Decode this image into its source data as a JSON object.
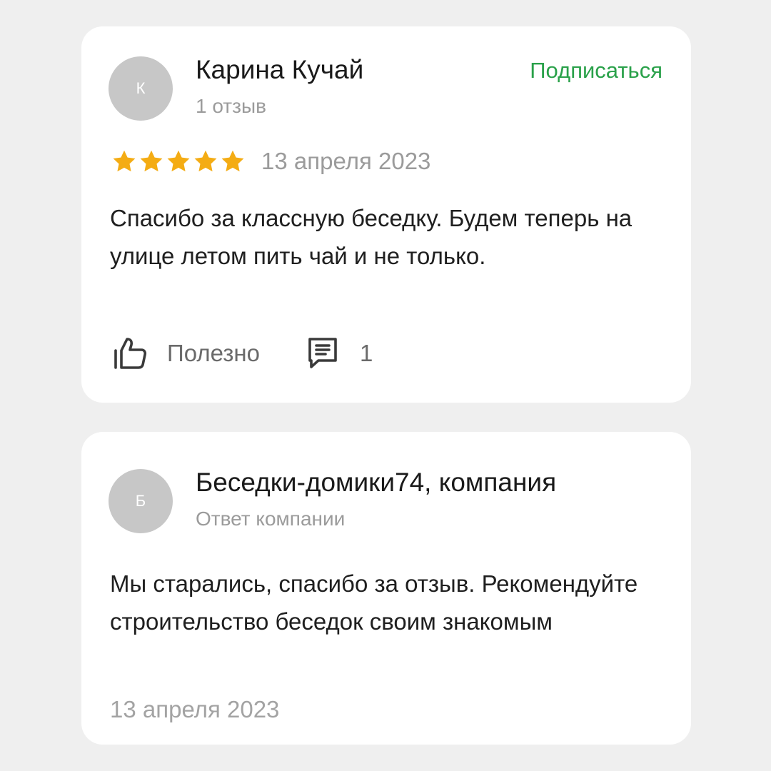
{
  "colors": {
    "background": "#efefef",
    "card": "#ffffff",
    "accent_green": "#2aa14a",
    "star_gold": "#f4ac14",
    "muted_text": "#9b9b9b",
    "avatar_gray": "#c7c7c7"
  },
  "review": {
    "author": {
      "initial": "К",
      "name": "Карина Кучай",
      "subtitle": "1 отзыв"
    },
    "subscribe_label": "Подписаться",
    "rating": 5,
    "rating_max": 5,
    "date": "13 апреля 2023",
    "text": "Спасибо за классную беседку. Будем теперь на улице летом пить чай и не только.",
    "helpful_label": "Полезно",
    "helpful_icon": "thumbs-up-icon",
    "comments_icon": "comment-icon",
    "comments_count": "1"
  },
  "reply": {
    "author": {
      "initial": "Б",
      "name": "Беседки-домики74, компания",
      "subtitle": "Ответ компании"
    },
    "text": "Мы старались, спасибо за отзыв. Рекомендуйте строительство беседок своим знакомым",
    "date": "13 апреля 2023"
  }
}
